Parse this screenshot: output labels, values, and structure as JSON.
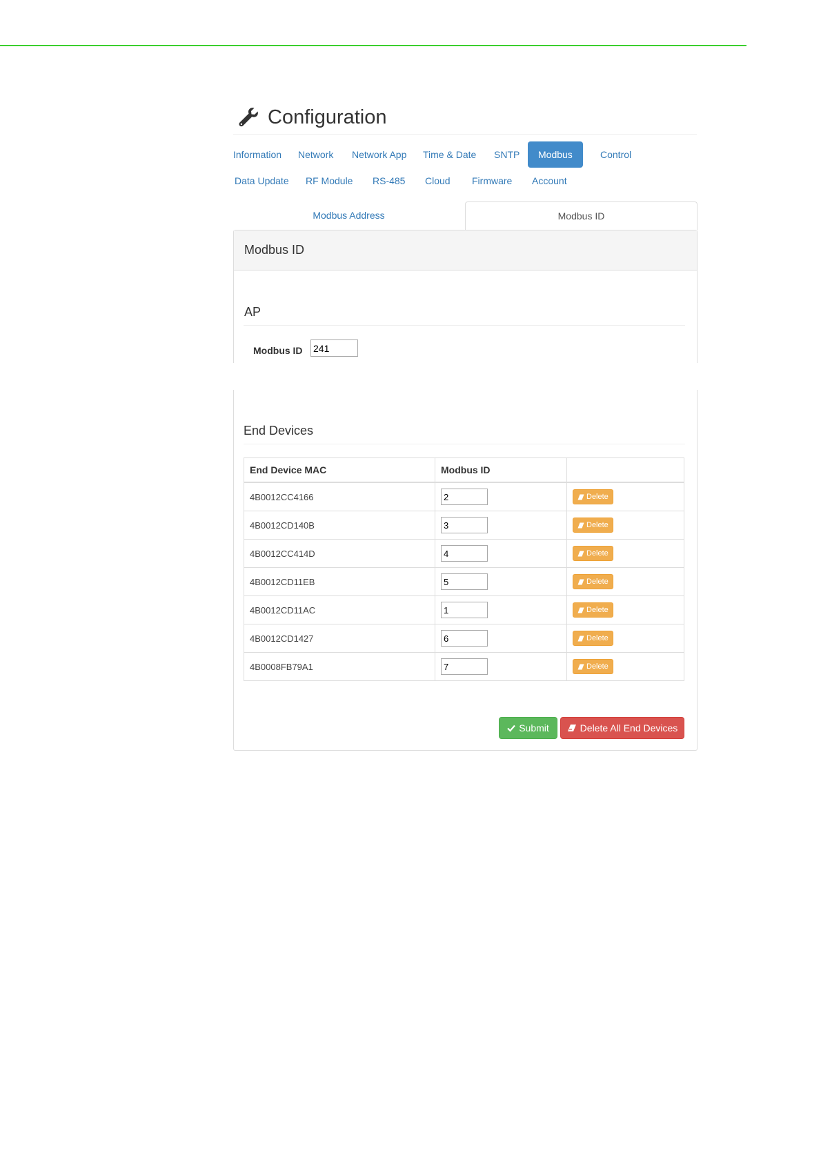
{
  "header": {
    "title": "Configuration",
    "icon": "wrench-icon"
  },
  "nav": {
    "row1": [
      "Information",
      "Network",
      "Network App",
      "Time & Date",
      "SNTP",
      "Modbus",
      "Control"
    ],
    "row2": [
      "Data Update",
      "RF Module",
      "RS-485",
      "Cloud",
      "Firmware",
      "Account"
    ],
    "active": "Modbus"
  },
  "subtabs": {
    "inactive": "Modbus Address",
    "active": "Modbus ID"
  },
  "panel": {
    "heading": "Modbus ID"
  },
  "ap": {
    "section_title": "AP",
    "label": "Modbus ID",
    "value": "241"
  },
  "end_devices": {
    "section_title": "End Devices",
    "columns": [
      "End Device MAC",
      "Modbus ID",
      ""
    ],
    "rows": [
      {
        "mac": "4B0012CC4166",
        "id": "2"
      },
      {
        "mac": "4B0012CD140B",
        "id": "3"
      },
      {
        "mac": "4B0012CC414D",
        "id": "4"
      },
      {
        "mac": "4B0012CD11EB",
        "id": "5"
      },
      {
        "mac": "4B0012CD11AC",
        "id": "1"
      },
      {
        "mac": "4B0012CD1427",
        "id": "6"
      },
      {
        "mac": "4B0008FB79A1",
        "id": "7"
      }
    ],
    "delete_label": "Delete"
  },
  "actions": {
    "submit_label": "Submit",
    "delete_all_label": "Delete All End Devices"
  },
  "colors": {
    "primary": "#428bca",
    "success": "#5cb85c",
    "warning": "#f0ad4e",
    "danger": "#d9534f",
    "top_rule": "#3ccf2f"
  }
}
